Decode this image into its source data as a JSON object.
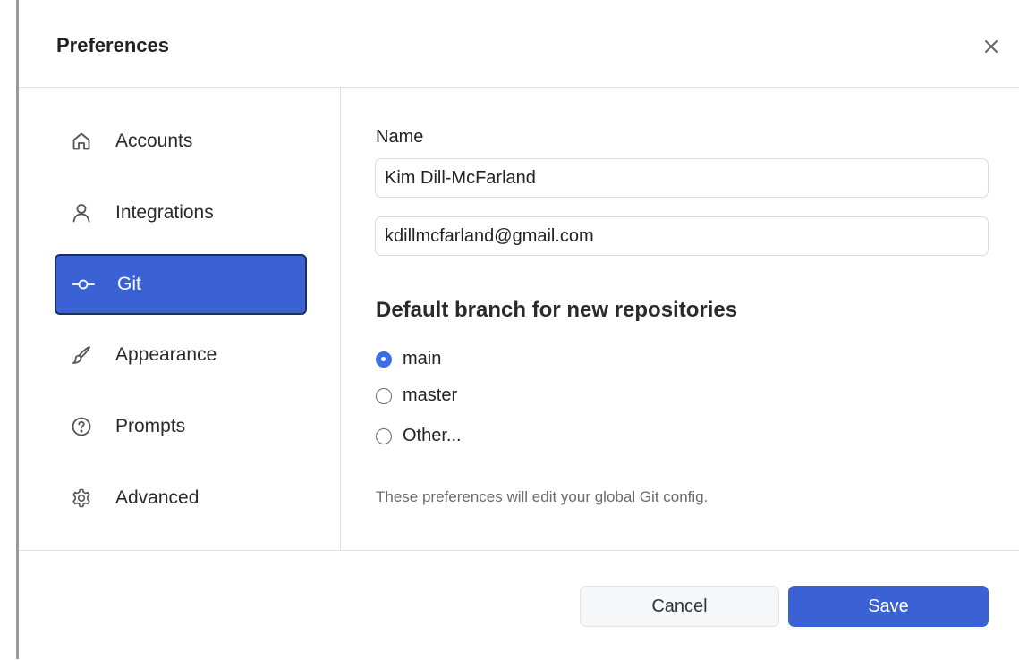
{
  "dialog": {
    "title": "Preferences",
    "close_icon": "close-icon"
  },
  "sidebar": {
    "items": [
      {
        "label": "Accounts",
        "icon": "home-icon",
        "active": false
      },
      {
        "label": "Integrations",
        "icon": "person-icon",
        "active": false
      },
      {
        "label": "Git",
        "icon": "git-commit-icon",
        "active": true
      },
      {
        "label": "Appearance",
        "icon": "brush-icon",
        "active": false
      },
      {
        "label": "Prompts",
        "icon": "question-circle-icon",
        "active": false
      },
      {
        "label": "Advanced",
        "icon": "gear-icon",
        "active": false
      }
    ]
  },
  "git": {
    "name_label": "Name",
    "name_value": "Kim Dill-McFarland",
    "email_value": "kdillmcfarland@gmail.com",
    "branch_heading": "Default branch for new repositories",
    "branch_options": [
      {
        "label": "main",
        "checked": true
      },
      {
        "label": "master",
        "checked": false
      },
      {
        "label": "Other...",
        "checked": false
      }
    ],
    "help_text": "These preferences will edit your global Git config."
  },
  "footer": {
    "cancel_label": "Cancel",
    "save_label": "Save"
  },
  "colors": {
    "accent": "#3a62d4",
    "radio_checked": "#3a6ee8"
  }
}
